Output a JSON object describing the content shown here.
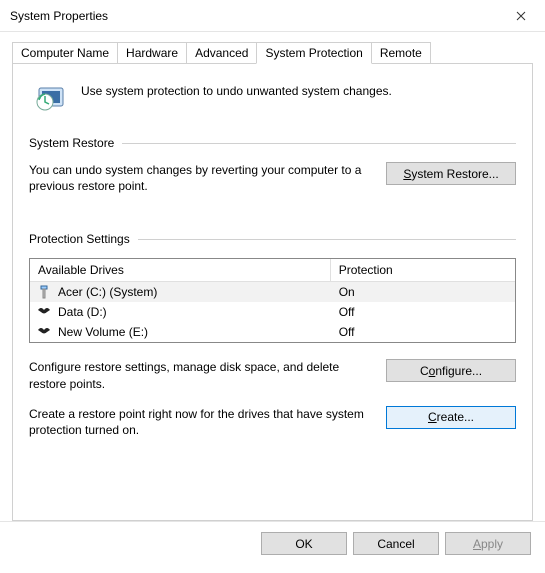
{
  "window": {
    "title": "System Properties"
  },
  "tabs": {
    "computer_name": "Computer Name",
    "hardware": "Hardware",
    "advanced": "Advanced",
    "system_protection": "System Protection",
    "remote": "Remote"
  },
  "intro_text": "Use system protection to undo unwanted system changes.",
  "restore_group": {
    "label": "System Restore",
    "desc": "You can undo system changes by reverting your computer to a previous restore point.",
    "button": "System Restore..."
  },
  "settings_group": {
    "label": "Protection Settings",
    "table": {
      "header_drive": "Available Drives",
      "header_protection": "Protection",
      "rows": [
        {
          "name": "Acer (C:) (System)",
          "protection": "On",
          "icon": "system",
          "selected": true
        },
        {
          "name": "Data (D:)",
          "protection": "Off",
          "icon": "bat",
          "selected": false
        },
        {
          "name": "New Volume (E:)",
          "protection": "Off",
          "icon": "bat",
          "selected": false
        }
      ]
    },
    "configure_desc": "Configure restore settings, manage disk space, and delete restore points.",
    "configure_btn": "Configure...",
    "create_desc": "Create a restore point right now for the drives that have system protection turned on.",
    "create_btn": "Create..."
  },
  "footer": {
    "ok": "OK",
    "cancel": "Cancel",
    "apply": "Apply"
  }
}
